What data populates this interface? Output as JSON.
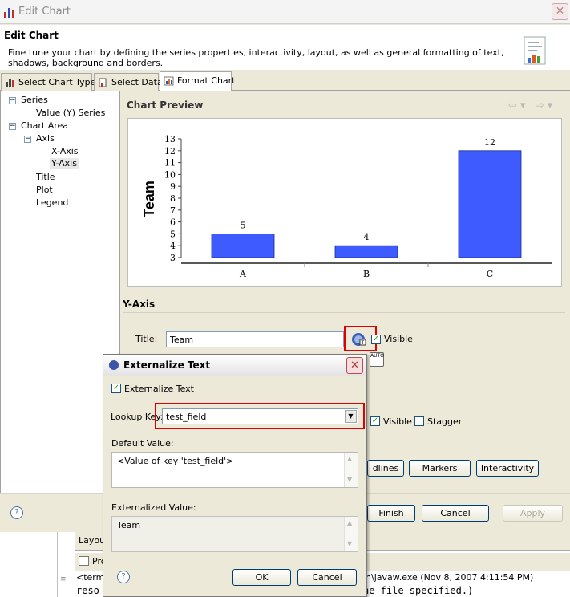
{
  "window": {
    "title": "Edit Chart"
  },
  "header": {
    "title": "Edit Chart",
    "description": "Fine tune your chart by defining the series properties, interactivity, layout, as well as general formatting of text, shadows, background and borders."
  },
  "tabs": [
    {
      "label": "Select Chart Type"
    },
    {
      "label": "Select Data"
    },
    {
      "label": "Format Chart"
    }
  ],
  "tree": {
    "series": "Series",
    "value_series": "Value (Y) Series",
    "chart_area": "Chart Area",
    "axis": "Axis",
    "x_axis": "X-Axis",
    "y_axis": "Y-Axis",
    "title": "Title",
    "plot": "Plot",
    "legend": "Legend"
  },
  "preview": {
    "title": "Chart Preview",
    "nav_back": "⇦ ▾",
    "nav_forward": "⇨ ▾"
  },
  "chart_data": {
    "type": "bar",
    "categories": [
      "A",
      "B",
      "C"
    ],
    "values": [
      5,
      4,
      12
    ],
    "ylabel": "Team",
    "ylim": [
      3,
      13
    ],
    "yticks": [
      3,
      4,
      5,
      6,
      7,
      8,
      9,
      10,
      11,
      12,
      13
    ],
    "bar_color": "#3d5bff",
    "data_labels": [
      "5",
      "4",
      "12"
    ],
    "grid": false
  },
  "yaxis_section": {
    "heading": "Y-Axis",
    "title_label": "Title:",
    "title_value": "Team",
    "visible_label": "Visible",
    "visible_label_2": "Visible",
    "stagger_label": "Stagger"
  },
  "buttons": {
    "gridlines": "dlines",
    "markers": "Markers",
    "interactivity": "Interactivity",
    "finish": "Finish",
    "cancel": "Cancel",
    "apply": "Apply",
    "help": "?"
  },
  "background": {
    "layout_tab": "Layou",
    "problems_tab": "Pro",
    "console_line1_left": "<termi",
    "console_line1_right": "in\\javaw.exe (Nov 8, 2007 4:11:54 PM)",
    "console_line2_left": "reso",
    "console_line2_right": "he file specified.)"
  },
  "ext_dialog": {
    "title": "Externalize Text",
    "externalize_checkbox": "Externalize Text",
    "lookup_label": "Lookup Key:",
    "lookup_value": "test_field",
    "default_label": "Default Value:",
    "default_value": "<Value of key 'test_field'>",
    "externalized_label": "Externalized Value:",
    "externalized_value": "Team",
    "ok": "OK",
    "cancel": "Cancel",
    "help": "?"
  }
}
